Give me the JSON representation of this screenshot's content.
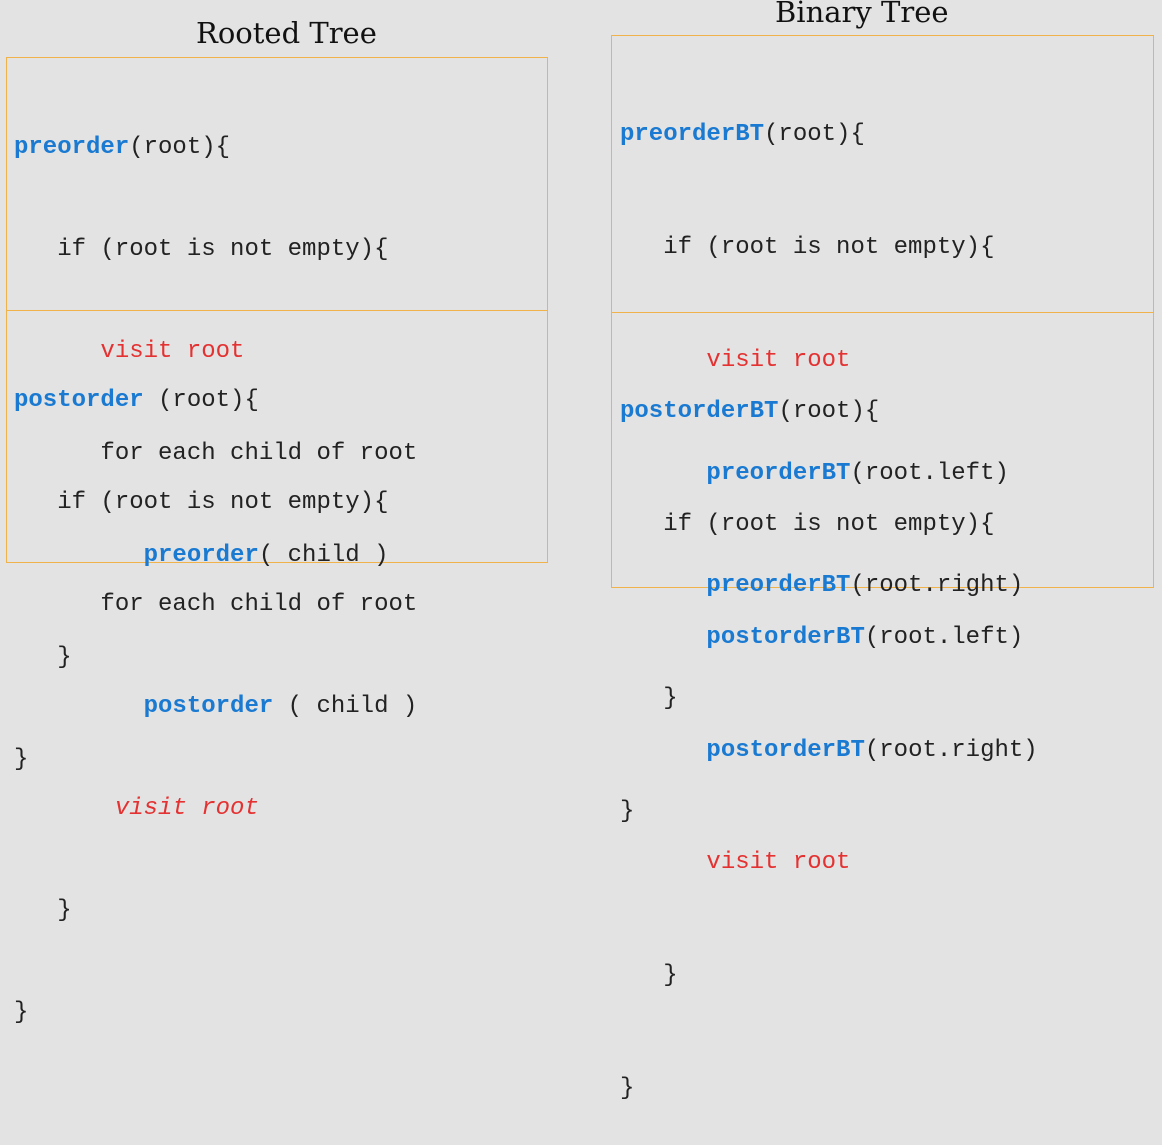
{
  "titles": {
    "rooted": "Rooted Tree",
    "binary": "Binary Tree"
  },
  "rooted_tree": {
    "preorder": {
      "signature_name": "preorder",
      "signature_args": "(root){",
      "if_line": "if (root is not empty){",
      "visit": "visit root",
      "for_line": "for each child of root",
      "call_name": "preorder",
      "call_args": "( child )",
      "close_inner": "}",
      "close_outer": "}"
    },
    "postorder": {
      "signature_name": "postorder",
      "signature_args": " (root){",
      "if_line": "if (root is not empty){",
      "for_line": "for each child of root",
      "call_name": "postorder",
      "call_args": " ( child )",
      "visit": "visit root",
      "close_inner": "}",
      "close_outer": "}"
    }
  },
  "binary_tree": {
    "preorder": {
      "signature_name": "preorderBT",
      "signature_args": "(root){",
      "if_line": "if (root is not empty){",
      "visit": "visit root",
      "call_name": "preorderBT",
      "left_args": "(root.left)",
      "right_args": "(root.right)",
      "close_inner": "}",
      "close_outer": "}"
    },
    "postorder": {
      "signature_name": "postorderBT",
      "signature_args": "(root){",
      "if_line": "if (root is not empty){",
      "call_name": "postorderBT",
      "left_args": "(root.left)",
      "right_args": "(root.right)",
      "visit": "visit root",
      "close_inner": "}",
      "close_outer": "}"
    }
  },
  "colors": {
    "background": "#e3e3e3",
    "keyword": "#1a7ad2",
    "visit": "#e43131",
    "box_border": "#f0b24a",
    "text": "#222222"
  }
}
